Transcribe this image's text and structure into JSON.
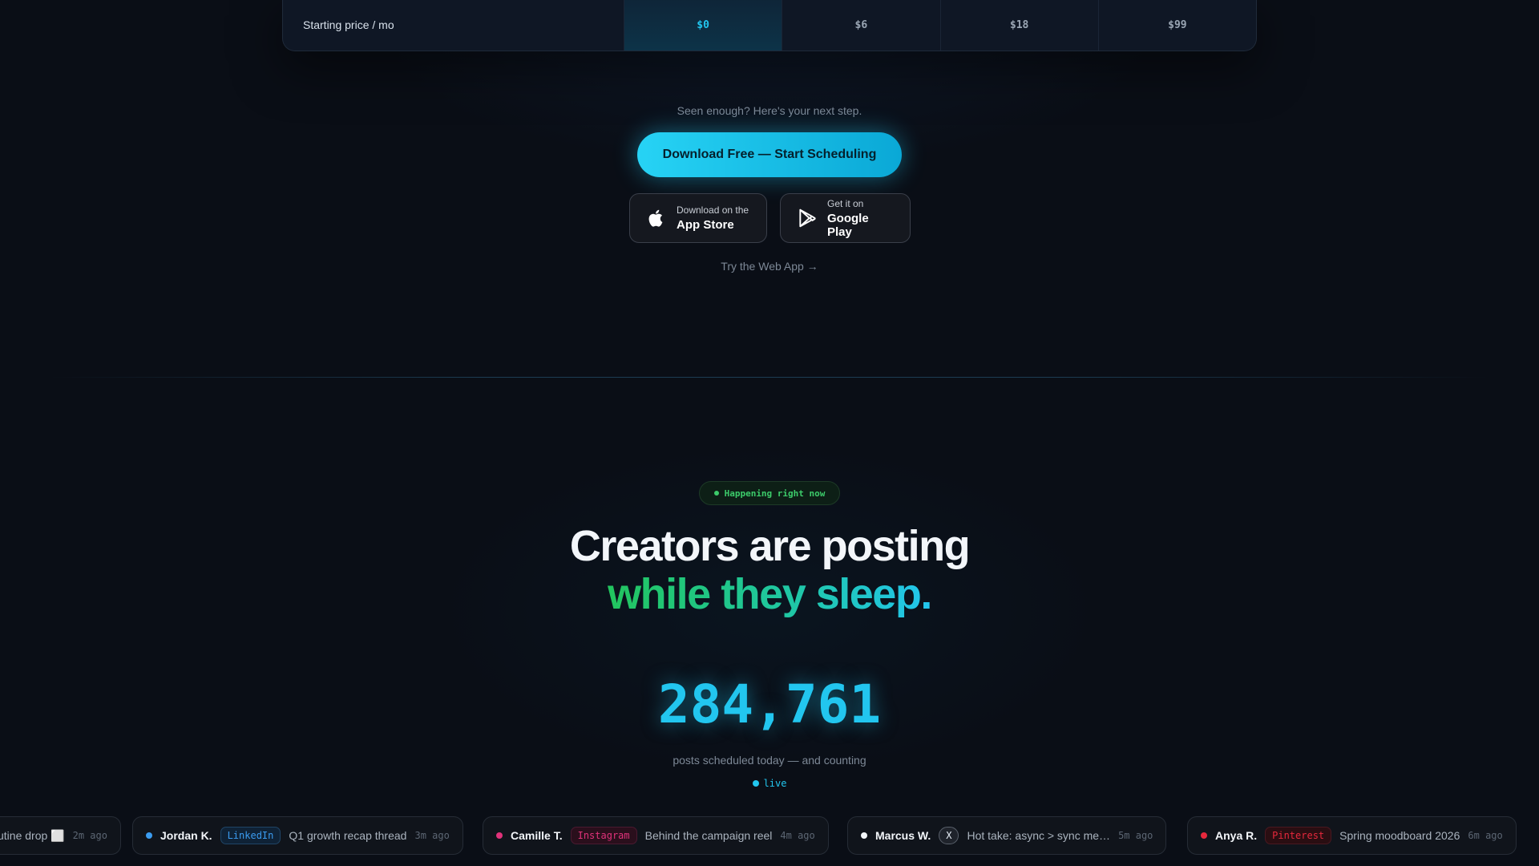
{
  "pricing": {
    "row_label": "Starting price / mo",
    "prices": [
      "$0",
      "$6",
      "$18",
      "$99"
    ]
  },
  "cta_section": {
    "prompt": "Seen enough? Here's your next step.",
    "primary_button": "Download Free — Start Scheduling",
    "app_store": {
      "small": "Download on the",
      "big": "App Store"
    },
    "google_play": {
      "small": "Get it on",
      "big": "Google Play"
    },
    "web_link": "Try the Web App →"
  },
  "live_section": {
    "badge": "Happening right now",
    "headline_line1": "Creators are posting",
    "headline_line2": "while they sleep.",
    "counter": "284,761",
    "counter_label": "posts scheduled today — and counting",
    "live_label": "live"
  },
  "feed": [
    {
      "name": "",
      "platform": "",
      "text": "utine drop ⬜",
      "time": "2m ago",
      "dot_color": "#3b82f6"
    },
    {
      "name": "Jordan K.",
      "platform": "LinkedIn",
      "text": "Q1 growth recap thread",
      "time": "3m ago",
      "dot_color": "#3b9cf0"
    },
    {
      "name": "Camille T.",
      "platform": "Instagram",
      "text": "Behind the campaign reel",
      "time": "4m ago",
      "dot_color": "#e0327a"
    },
    {
      "name": "Marcus W.",
      "platform": "X",
      "text": "Hot take: async > sync me…",
      "time": "5m ago",
      "dot_color": "#f3f6fa"
    },
    {
      "name": "Anya R.",
      "platform": "Pinterest",
      "text": "Spring moodboard 2026",
      "time": "6m ago",
      "dot_color": "#e6283c"
    }
  ],
  "colors": {
    "accent": "#22c6ef",
    "green": "#22c55e",
    "linkedin": "#3b9cf0",
    "instagram": "#e0327a",
    "pinterest": "#e6283c"
  }
}
